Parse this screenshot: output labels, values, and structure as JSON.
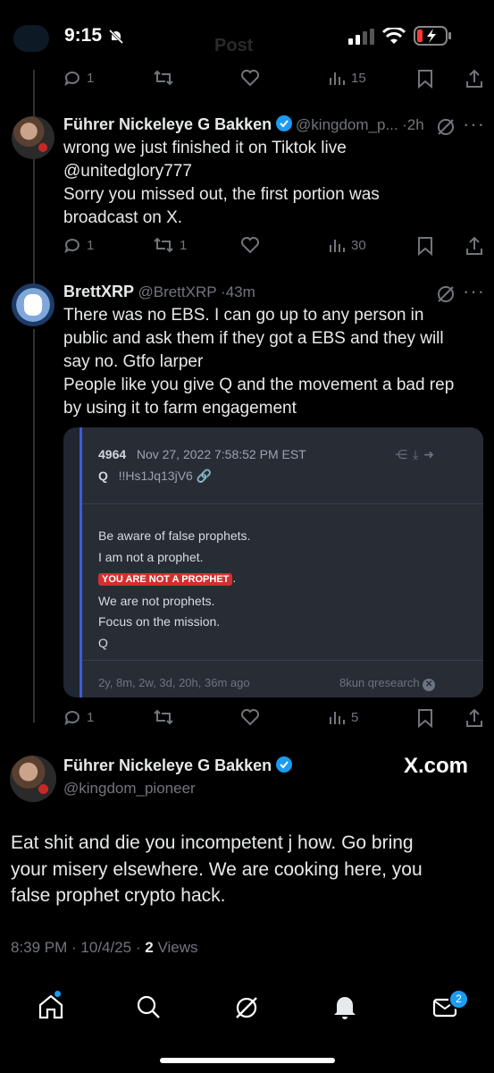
{
  "status_bar": {
    "time": "9:15",
    "blur_title": "Post"
  },
  "top_actions": {
    "reply_count": "1",
    "views": "15"
  },
  "tweet1": {
    "author_name": "Führer Nickeleye G Bakken",
    "handle": "@kingdom_p...",
    "time": "2h",
    "text_line1": "wrong we just finished it on Tiktok live",
    "text_line2": "@unitedglory777",
    "text_line3": "Sorry you missed out, the first portion was",
    "text_line4": "broadcast on X.",
    "reply_count": "1",
    "retweet_count": "1",
    "views": "30"
  },
  "tweet2": {
    "author_name": "BrettXRP",
    "handle": "@BrettXRP",
    "time": "43m",
    "text_line1": "There was no EBS. I can go up to any person in",
    "text_line2": "public and ask them if they got a EBS and they will",
    "text_line3": "say no. Gtfo larper",
    "text_line4": "People like you give Q and the movement a bad rep",
    "text_line5": "by using it to farm engagement",
    "reply_count": "1",
    "views": "5",
    "card": {
      "post_number": "4964",
      "date": "Nov 27, 2022 7:58:52 PM EST",
      "author": "Q",
      "tripcode": "!!Hs1Jq13jV6",
      "line1": "Be aware of false prophets.",
      "line2": "I am not a prophet.",
      "highlight": "YOU ARE NOT A PROPHET",
      "highlight_suffix": ".",
      "line4": "We are not prophets.",
      "line5": "Focus on the mission.",
      "line6": "Q",
      "footer_ago": "2y, 8m, 2w, 3d, 20h, 36m ago",
      "footer_source": "8kun qresearch"
    }
  },
  "main_tweet": {
    "author_name": "Führer Nickeleye G Bakken",
    "handle": "@kingdom_pioneer",
    "watermark": "X.com",
    "text_line1": "Eat shit and die you incompetent j how. Go bring",
    "text_line2": "your misery elsewhere. We are cooking here, you",
    "text_line3": "false prophet crypto hack.",
    "timestamp": "8:39 PM · 10/4/25 · ",
    "views_count": "2",
    "views_label": " Views"
  },
  "nav": {
    "messages_badge": "2"
  },
  "colors": {
    "accent": "#1d9bf0",
    "muted": "#71767b",
    "highlight": "#d32f2f"
  }
}
